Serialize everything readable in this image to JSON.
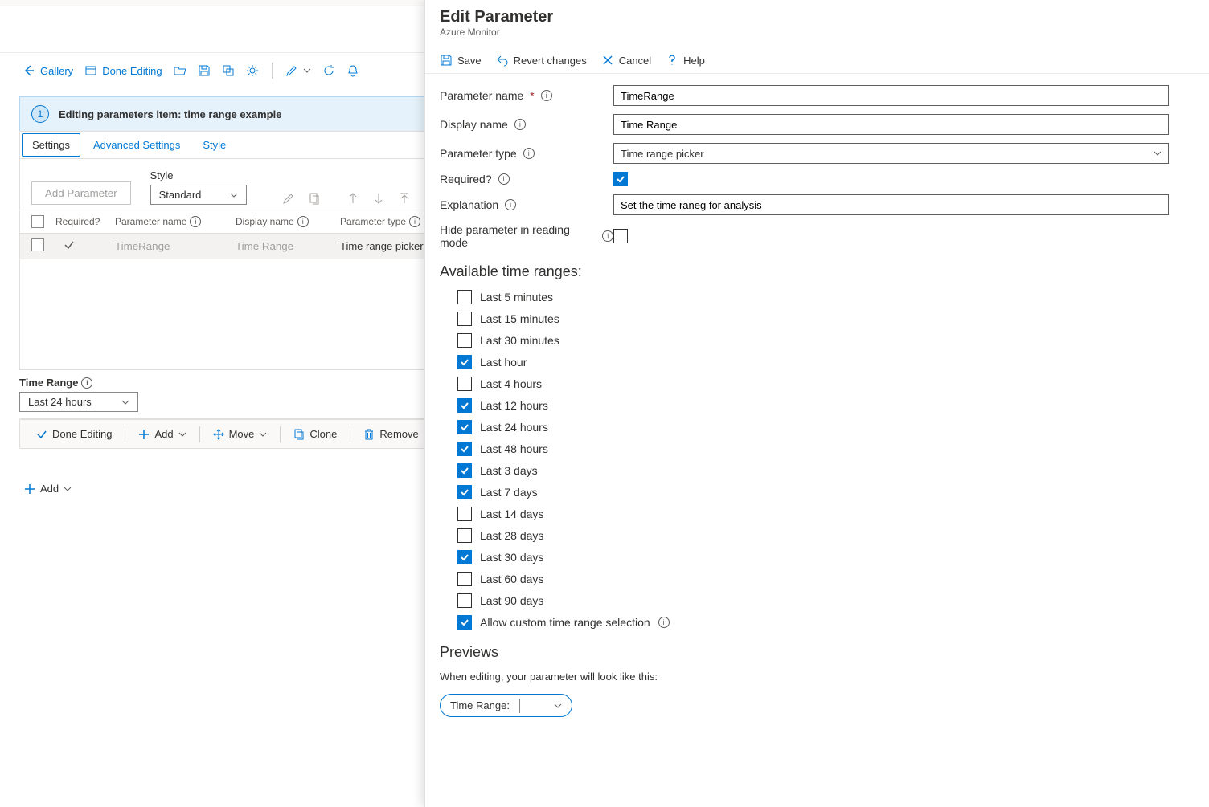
{
  "toolbar": {
    "gallery": "Gallery",
    "done_editing": "Done Editing"
  },
  "editing_banner": {
    "number": "1",
    "text": "Editing parameters item: time range example"
  },
  "tabs": {
    "settings": "Settings",
    "advanced": "Advanced Settings",
    "style": "Style"
  },
  "subbar": {
    "add_parameter": "Add Parameter",
    "style_label": "Style",
    "style_value": "Standard"
  },
  "table": {
    "headers": {
      "required": "Required?",
      "param_name": "Parameter name",
      "display_name": "Display name",
      "param_type": "Parameter type"
    },
    "row": {
      "param_name": "TimeRange",
      "display_name": "Time Range",
      "param_type": "Time range picker"
    }
  },
  "time_range_label": "Time Range",
  "time_range_value": "Last 24 hours",
  "card_actions": {
    "done_editing": "Done Editing",
    "add": "Add",
    "move": "Move",
    "clone": "Clone",
    "remove": "Remove"
  },
  "bottom_add": "Add",
  "panel": {
    "title": "Edit Parameter",
    "subtitle": "Azure Monitor",
    "toolbar": {
      "save": "Save",
      "revert": "Revert changes",
      "cancel": "Cancel",
      "help": "Help"
    },
    "form": {
      "param_name_label": "Parameter name",
      "param_name_value": "TimeRange",
      "display_name_label": "Display name",
      "display_name_value": "Time Range",
      "param_type_label": "Parameter type",
      "param_type_value": "Time range picker",
      "required_label": "Required?",
      "explanation_label": "Explanation",
      "explanation_value": "Set the time raneg for analysis",
      "hide_label": "Hide parameter in reading mode"
    },
    "ranges_title": "Available time ranges:",
    "ranges": [
      {
        "label": "Last 5 minutes",
        "checked": false
      },
      {
        "label": "Last 15 minutes",
        "checked": false
      },
      {
        "label": "Last 30 minutes",
        "checked": false
      },
      {
        "label": "Last hour",
        "checked": true
      },
      {
        "label": "Last 4 hours",
        "checked": false
      },
      {
        "label": "Last 12 hours",
        "checked": true
      },
      {
        "label": "Last 24 hours",
        "checked": true
      },
      {
        "label": "Last 48 hours",
        "checked": true
      },
      {
        "label": "Last 3 days",
        "checked": true
      },
      {
        "label": "Last 7 days",
        "checked": true
      },
      {
        "label": "Last 14 days",
        "checked": false
      },
      {
        "label": "Last 28 days",
        "checked": false
      },
      {
        "label": "Last 30 days",
        "checked": true
      },
      {
        "label": "Last 60 days",
        "checked": false
      },
      {
        "label": "Last 90 days",
        "checked": false
      },
      {
        "label": "Allow custom time range selection",
        "checked": true,
        "info": true
      }
    ],
    "previews_title": "Previews",
    "preview_note": "When editing, your parameter will look like this:",
    "preview_label": "Time Range:"
  }
}
